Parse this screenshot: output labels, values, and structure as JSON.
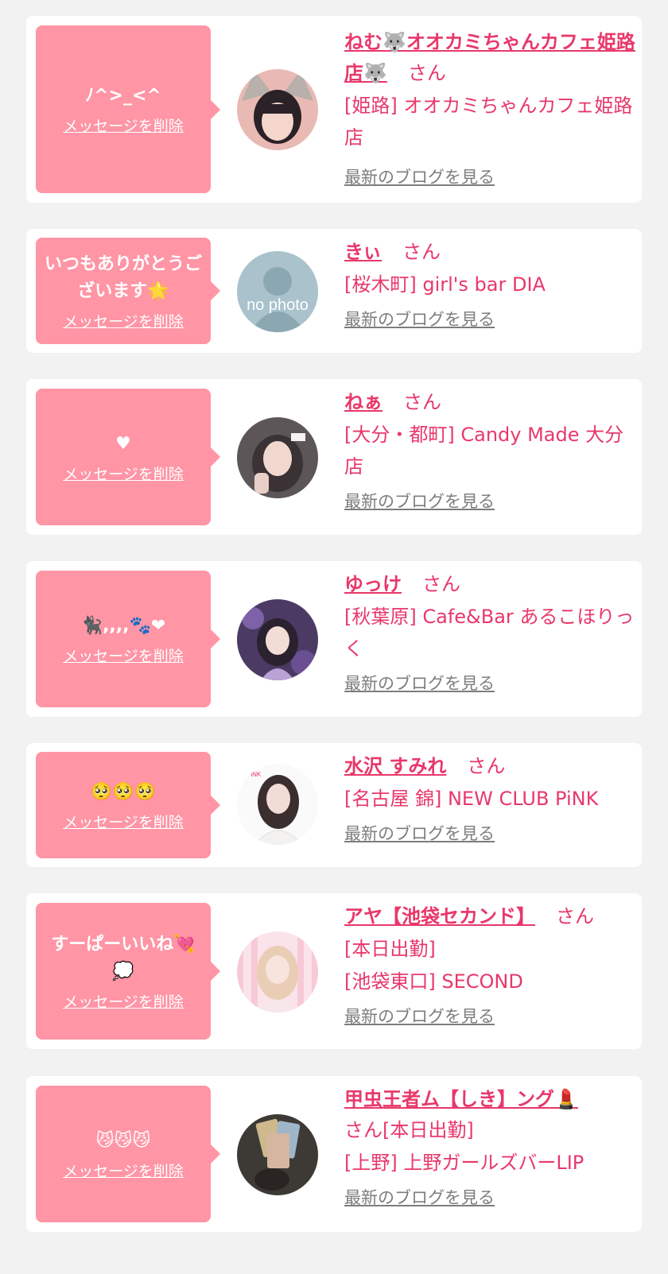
{
  "common": {
    "delete_label": "メッセージを削除",
    "blog_label": "最新のブログを見る"
  },
  "colors": {
    "accent": "#e8386a",
    "bubble": "#ff95a5",
    "link_gray": "#7d7d7d",
    "background": "#f2f2f2"
  },
  "messages": [
    {
      "message": "ﾉ^>_<^",
      "name": "ねむ🐺オオカミちゃんカフェ姫路店🐺",
      "honorific": "さん",
      "shop_lines": [
        "[姫路] オオカミちゃんカフェ姫路店"
      ]
    },
    {
      "message": "いつもありがとうございます🌟",
      "name": "きぃ",
      "honorific": "さん",
      "shop_lines": [
        "[桜木町] girl's bar DIA"
      ]
    },
    {
      "message": "♥",
      "name": "ねぁ",
      "honorific": "さん",
      "shop_lines": [
        "[大分・都町] Candy Made 大分店"
      ]
    },
    {
      "message": "🐈‍⬛,,,,🐾❤",
      "name": "ゆっけ",
      "honorific": "さん",
      "shop_lines": [
        "[秋葉原] Cafe&Bar あるこほりっく"
      ]
    },
    {
      "message": "🥺🥺🥺",
      "name": "水沢 すみれ",
      "honorific": "さん",
      "shop_lines": [
        "[名古屋 錦] NEW CLUB PiNK"
      ]
    },
    {
      "message": "すーぱーいいね💘💭",
      "name": "アヤ【池袋セカンド】",
      "honorific": "さん",
      "shop_lines": [
        "[本日出勤]",
        "[池袋東口] SECOND"
      ]
    },
    {
      "message": "😼😼😼",
      "name": "甲虫王者ム【しき】ング💄",
      "honorific": "さん[本日出勤]",
      "shop_lines": [
        "[上野] 上野ガールズバーLIP"
      ]
    }
  ]
}
